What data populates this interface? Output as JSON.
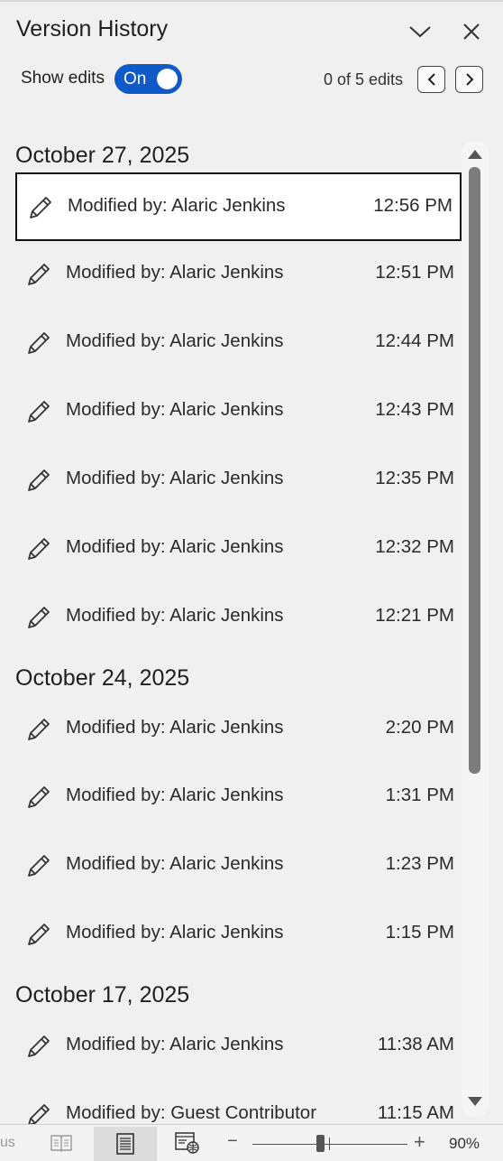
{
  "header": {
    "title": "Version History"
  },
  "toolbar": {
    "show_edits_label": "Show edits",
    "toggle_label": "On",
    "edit_count": "0 of 5 edits"
  },
  "groups": [
    {
      "date": "October 27, 2025",
      "entries": [
        {
          "who": "Modified by: Alaric Jenkins",
          "time": "12:56 PM"
        },
        {
          "who": "Modified by: Alaric Jenkins",
          "time": "12:51 PM"
        },
        {
          "who": "Modified by: Alaric Jenkins",
          "time": "12:44 PM"
        },
        {
          "who": "Modified by: Alaric Jenkins",
          "time": "12:43 PM"
        },
        {
          "who": "Modified by: Alaric Jenkins",
          "time": "12:35 PM"
        },
        {
          "who": "Modified by: Alaric Jenkins",
          "time": "12:32 PM"
        },
        {
          "who": "Modified by: Alaric Jenkins",
          "time": "12:21 PM"
        }
      ]
    },
    {
      "date": "October 24, 2025",
      "entries": [
        {
          "who": "Modified by: Alaric Jenkins",
          "time": "2:20 PM"
        },
        {
          "who": "Modified by: Alaric Jenkins",
          "time": "1:31 PM"
        },
        {
          "who": "Modified by: Alaric Jenkins",
          "time": "1:23 PM"
        },
        {
          "who": "Modified by: Alaric Jenkins",
          "time": "1:15 PM"
        }
      ]
    },
    {
      "date": "October 17, 2025",
      "entries": [
        {
          "who": "Modified by: Alaric Jenkins",
          "time": "11:38 AM"
        },
        {
          "who": "Modified by: Guest Contributor",
          "time": "11:15 AM"
        }
      ]
    }
  ],
  "statusbar": {
    "cut_text": "us",
    "zoom_minus": "−",
    "zoom_plus": "+",
    "zoom_level": "90%"
  },
  "icons": {
    "edit": "pencil-icon",
    "collapse": "chevron-down-icon",
    "close": "close-icon",
    "prev": "chevron-left-icon",
    "next": "chevron-right-icon"
  },
  "colors": {
    "accent": "#0f5ac8",
    "panel": "#f0f0f0"
  }
}
